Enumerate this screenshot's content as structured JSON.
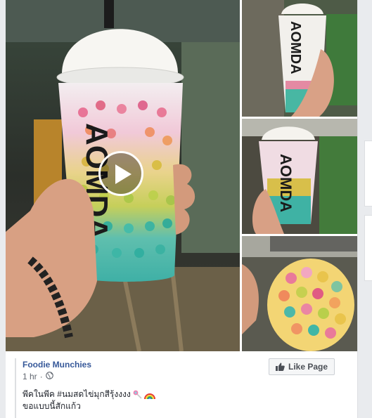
{
  "post": {
    "page_name": "Foodie Munchies",
    "time_ago": "1 hr",
    "separator": "·",
    "text_line1": "พีคในพีค #นมสดไข่มุกสีรุ้งงงง",
    "text_line2": "ขอแบบนี้สักแก้ว",
    "like_button_label": "Like Page"
  },
  "media": {
    "cup_brand_text": "AOMDA"
  },
  "colors": {
    "link_blue": "#365899",
    "meta_gray": "#616770",
    "page_bg": "#e9ebee"
  },
  "icons": [
    "play-icon",
    "globe-icon",
    "like-thumb-icon",
    "lollipop-icon",
    "rainbow-icon"
  ]
}
